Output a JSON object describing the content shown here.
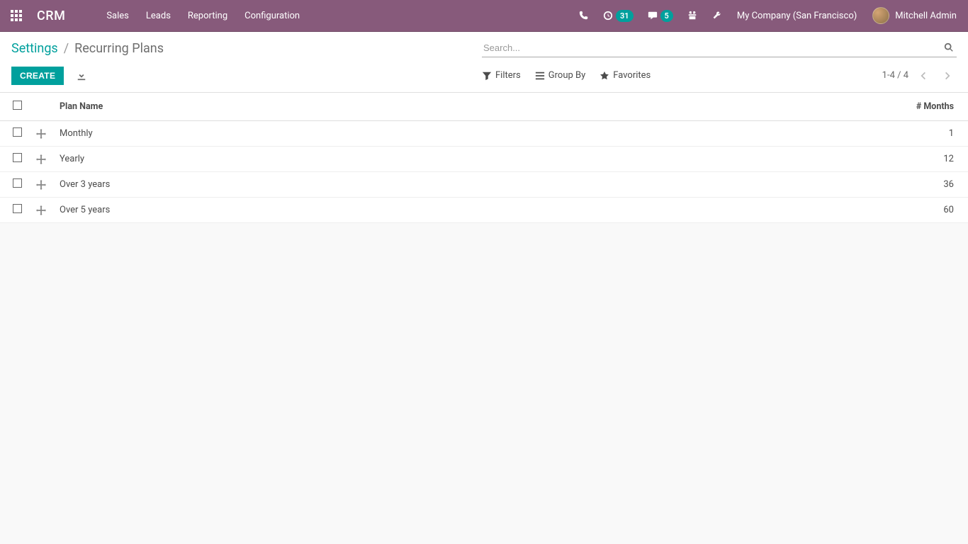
{
  "topbar": {
    "brand": "CRM",
    "menu": [
      "Sales",
      "Leads",
      "Reporting",
      "Configuration"
    ],
    "activities_badge": "31",
    "messages_badge": "5",
    "company": "My Company (San Francisco)",
    "user": "Mitchell Admin"
  },
  "breadcrumb": {
    "parent": "Settings",
    "current": "Recurring Plans"
  },
  "search": {
    "placeholder": "Search..."
  },
  "toolbar": {
    "create_label": "CREATE",
    "filters_label": "Filters",
    "groupby_label": "Group By",
    "favorites_label": "Favorites",
    "pager": "1-4 / 4"
  },
  "table": {
    "headers": {
      "name": "Plan Name",
      "months": "# Months"
    },
    "rows": [
      {
        "name": "Monthly",
        "months": "1"
      },
      {
        "name": "Yearly",
        "months": "12"
      },
      {
        "name": "Over 3 years",
        "months": "36"
      },
      {
        "name": "Over 5 years",
        "months": "60"
      }
    ]
  }
}
